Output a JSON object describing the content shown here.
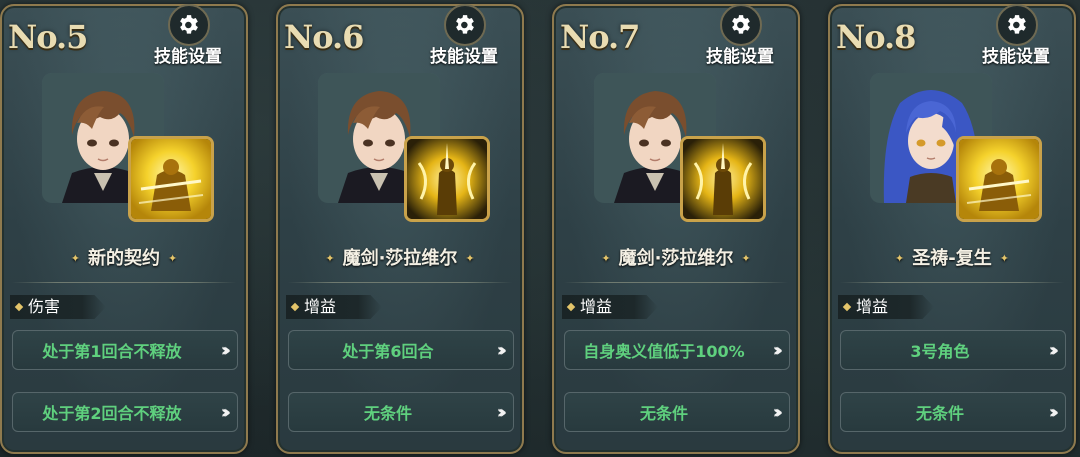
{
  "cards": [
    {
      "number": "No.5",
      "settings_label": "技能设置",
      "character": "brown-haired-swordsman",
      "skill_icon": "golden-warrior-icon",
      "skill_name": "新的契约",
      "tag": "伤害",
      "conditions": [
        "处于第1回合不释放",
        "处于第2回合不释放"
      ]
    },
    {
      "number": "No.6",
      "settings_label": "技能设置",
      "character": "brown-haired-swordsman",
      "skill_icon": "demon-sword-icon",
      "skill_name": "魔剑·莎拉维尔",
      "tag": "增益",
      "conditions": [
        "处于第6回合",
        "无条件"
      ]
    },
    {
      "number": "No.7",
      "settings_label": "技能设置",
      "character": "brown-haired-swordsman",
      "skill_icon": "demon-sword-icon",
      "skill_name": "魔剑·莎拉维尔",
      "tag": "增益",
      "conditions": [
        "自身奥义值低于100%",
        "无条件"
      ]
    },
    {
      "number": "No.8",
      "settings_label": "技能设置",
      "character": "blue-haired-maiden",
      "skill_icon": "golden-warrior-icon",
      "skill_name": "圣祷-复生",
      "tag": "增益",
      "conditions": [
        "3号角色",
        "无条件"
      ]
    }
  ],
  "colors": {
    "frame": "#8f7a4e",
    "condition_text": "#5fd07e",
    "accent_gold": "#e3c46a"
  }
}
